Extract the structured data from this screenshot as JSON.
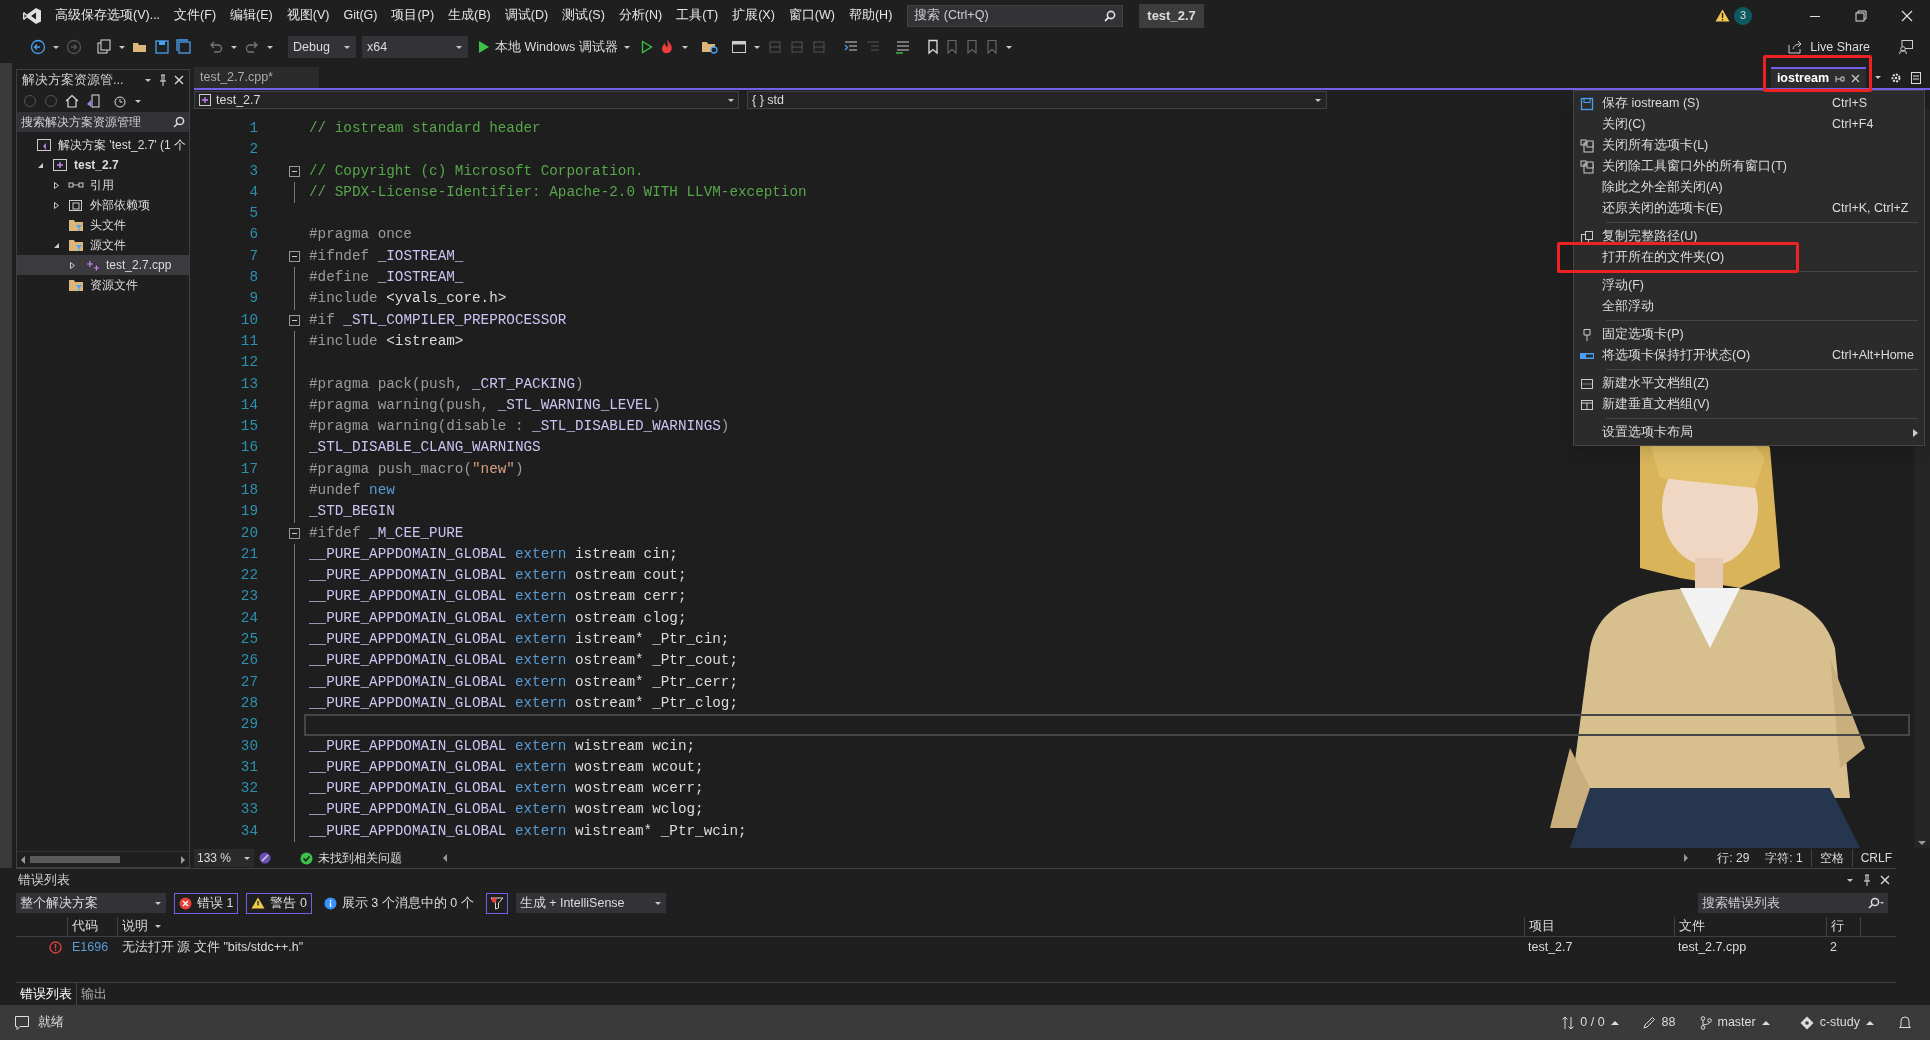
{
  "title_bar": {
    "menu": [
      "高级保存选项(V)...",
      "文件(F)",
      "编辑(E)",
      "视图(V)",
      "Git(G)",
      "项目(P)",
      "生成(B)",
      "调试(D)",
      "测试(S)",
      "分析(N)",
      "工具(T)",
      "扩展(X)",
      "窗口(W)",
      "帮助(H)"
    ],
    "search_placeholder": "搜索 (Ctrl+Q)",
    "solution_name": "test_2.7",
    "notification_count": "3"
  },
  "toolbar": {
    "configuration": "Debug",
    "platform": "x64",
    "run_target": "本地 Windows 调试器",
    "live_share": "Live Share"
  },
  "solution_explorer": {
    "title": "解决方案资源管...",
    "search_placeholder": "搜索解决方案资源管理",
    "tree": [
      {
        "label": "解决方案 'test_2.7' (1 个",
        "kind": "solution",
        "expandable": false,
        "selected": false,
        "children": [
          {
            "label": "test_2.7",
            "kind": "project",
            "expandable": true,
            "expanded": true,
            "selected": false,
            "children": [
              {
                "label": "引用",
                "kind": "reference",
                "expandable": true,
                "expanded": false,
                "selected": false
              },
              {
                "label": "外部依赖项",
                "kind": "external",
                "expandable": true,
                "expanded": false,
                "selected": false
              },
              {
                "label": "头文件",
                "kind": "folder",
                "expandable": false,
                "selected": false
              },
              {
                "label": "源文件",
                "kind": "folder",
                "expandable": true,
                "expanded": true,
                "selected": false,
                "children": [
                  {
                    "label": "test_2.7.cpp",
                    "kind": "file",
                    "expandable": true,
                    "expanded": false,
                    "selected": true
                  }
                ]
              },
              {
                "label": "资源文件",
                "kind": "folder",
                "expandable": false,
                "selected": false
              }
            ]
          }
        ]
      }
    ]
  },
  "editor": {
    "tabs": [
      {
        "label": "test_2.7.cpp*",
        "selected": false,
        "marked": false
      },
      {
        "label": "iostream",
        "selected": true,
        "marked": true
      }
    ],
    "project_dropdown": "test_2.7",
    "scope_dropdown": "{ } std",
    "lines": [
      {
        "number": "1",
        "fold": false,
        "current": false,
        "tokens": [
          {
            "kind": "comment",
            "text": "// iostream standard header"
          }
        ]
      },
      {
        "number": "2",
        "fold": false,
        "current": false
      },
      {
        "number": "3",
        "fold": true,
        "current": false,
        "tokens": [
          {
            "kind": "comment",
            "text": "// Copyright (c) Microsoft Corporation."
          }
        ]
      },
      {
        "number": "4",
        "fold": false,
        "current": false,
        "tokens": [
          {
            "kind": "comment",
            "text": "// SPDX-License-Identifier: Apache-2.0 WITH LLVM-exception"
          }
        ]
      },
      {
        "number": "5",
        "fold": false,
        "current": false
      },
      {
        "number": "6",
        "fold": false,
        "current": false,
        "tokens": [
          {
            "kind": "directive",
            "text": "#pragma once"
          }
        ]
      },
      {
        "number": "7",
        "fold": true,
        "current": false,
        "tokens": [
          {
            "kind": "directive",
            "text": "#ifndef "
          },
          {
            "kind": "macro",
            "text": "_IOSTREAM_"
          }
        ]
      },
      {
        "number": "8",
        "fold": false,
        "current": false,
        "tokens": [
          {
            "kind": "directive",
            "text": "#define "
          },
          {
            "kind": "macro",
            "text": "_IOSTREAM_"
          }
        ]
      },
      {
        "number": "9",
        "fold": false,
        "current": false,
        "tokens": [
          {
            "kind": "directive",
            "text": "#include "
          },
          {
            "kind": "plain",
            "text": "<yvals_core.h>"
          }
        ]
      },
      {
        "number": "10",
        "fold": true,
        "current": false,
        "tokens": [
          {
            "kind": "directive",
            "text": "#if "
          },
          {
            "kind": "macro",
            "text": "_STL_COMPILER_PREPROCESSOR"
          }
        ]
      },
      {
        "number": "11",
        "fold": false,
        "current": false,
        "tokens": [
          {
            "kind": "directive",
            "text": "#include "
          },
          {
            "kind": "plain",
            "text": "<istream>"
          }
        ]
      },
      {
        "number": "12",
        "fold": false,
        "current": false
      },
      {
        "number": "13",
        "fold": false,
        "current": false,
        "tokens": [
          {
            "kind": "directive",
            "text": "#pragma pack(push, "
          },
          {
            "kind": "macro",
            "text": "_CRT_PACKING"
          },
          {
            "kind": "directive",
            "text": ")"
          }
        ]
      },
      {
        "number": "14",
        "fold": false,
        "current": false,
        "tokens": [
          {
            "kind": "directive",
            "text": "#pragma warning(push, "
          },
          {
            "kind": "macro",
            "text": "_STL_WARNING_LEVEL"
          },
          {
            "kind": "directive",
            "text": ")"
          }
        ]
      },
      {
        "number": "15",
        "fold": false,
        "current": false,
        "tokens": [
          {
            "kind": "directive",
            "text": "#pragma warning(disable : "
          },
          {
            "kind": "macro",
            "text": "_STL_DISABLED_WARNINGS"
          },
          {
            "kind": "directive",
            "text": ")"
          }
        ]
      },
      {
        "number": "16",
        "fold": false,
        "current": false,
        "tokens": [
          {
            "kind": "macro",
            "text": "_STL_DISABLE_CLANG_WARNINGS"
          }
        ]
      },
      {
        "number": "17",
        "fold": false,
        "current": false,
        "tokens": [
          {
            "kind": "directive",
            "text": "#pragma push_macro("
          },
          {
            "kind": "string",
            "text": "\"new\""
          },
          {
            "kind": "directive",
            "text": ")"
          }
        ]
      },
      {
        "number": "18",
        "fold": false,
        "current": false,
        "tokens": [
          {
            "kind": "directive",
            "text": "#undef "
          },
          {
            "kind": "keyword",
            "text": "new"
          }
        ]
      },
      {
        "number": "19",
        "fold": false,
        "current": false,
        "tokens": [
          {
            "kind": "macro",
            "text": "_STD_BEGIN"
          }
        ]
      },
      {
        "number": "20",
        "fold": true,
        "current": false,
        "tokens": [
          {
            "kind": "directive",
            "text": "#ifdef "
          },
          {
            "kind": "macro",
            "text": "_M_CEE_PURE"
          }
        ]
      },
      {
        "number": "21",
        "fold": false,
        "current": false,
        "tokens": [
          {
            "kind": "macro",
            "text": "__PURE_APPDOMAIN_GLOBAL "
          },
          {
            "kind": "keyword",
            "text": "extern"
          },
          {
            "kind": "plain",
            "text": " istream cin;"
          }
        ]
      },
      {
        "number": "22",
        "fold": false,
        "current": false,
        "tokens": [
          {
            "kind": "macro",
            "text": "__PURE_APPDOMAIN_GLOBAL "
          },
          {
            "kind": "keyword",
            "text": "extern"
          },
          {
            "kind": "plain",
            "text": " ostream cout;"
          }
        ]
      },
      {
        "number": "23",
        "fold": false,
        "current": false,
        "tokens": [
          {
            "kind": "macro",
            "text": "__PURE_APPDOMAIN_GLOBAL "
          },
          {
            "kind": "keyword",
            "text": "extern"
          },
          {
            "kind": "plain",
            "text": " ostream cerr;"
          }
        ]
      },
      {
        "number": "24",
        "fold": false,
        "current": false,
        "tokens": [
          {
            "kind": "macro",
            "text": "__PURE_APPDOMAIN_GLOBAL "
          },
          {
            "kind": "keyword",
            "text": "extern"
          },
          {
            "kind": "plain",
            "text": " ostream clog;"
          }
        ]
      },
      {
        "number": "25",
        "fold": false,
        "current": false,
        "tokens": [
          {
            "kind": "macro",
            "text": "__PURE_APPDOMAIN_GLOBAL "
          },
          {
            "kind": "keyword",
            "text": "extern"
          },
          {
            "kind": "plain",
            "text": " istream* _Ptr_cin;"
          }
        ]
      },
      {
        "number": "26",
        "fold": false,
        "current": false,
        "tokens": [
          {
            "kind": "macro",
            "text": "__PURE_APPDOMAIN_GLOBAL "
          },
          {
            "kind": "keyword",
            "text": "extern"
          },
          {
            "kind": "plain",
            "text": " ostream* _Ptr_cout;"
          }
        ]
      },
      {
        "number": "27",
        "fold": false,
        "current": false,
        "tokens": [
          {
            "kind": "macro",
            "text": "__PURE_APPDOMAIN_GLOBAL "
          },
          {
            "kind": "keyword",
            "text": "extern"
          },
          {
            "kind": "plain",
            "text": " ostream* _Ptr_cerr;"
          }
        ]
      },
      {
        "number": "28",
        "fold": false,
        "current": false,
        "tokens": [
          {
            "kind": "macro",
            "text": "__PURE_APPDOMAIN_GLOBAL "
          },
          {
            "kind": "keyword",
            "text": "extern"
          },
          {
            "kind": "plain",
            "text": " ostream* _Ptr_clog;"
          }
        ]
      },
      {
        "number": "29",
        "fold": false,
        "current": true
      },
      {
        "number": "30",
        "fold": false,
        "current": false,
        "tokens": [
          {
            "kind": "macro",
            "text": "__PURE_APPDOMAIN_GLOBAL "
          },
          {
            "kind": "keyword",
            "text": "extern"
          },
          {
            "kind": "plain",
            "text": " wistream wcin;"
          }
        ]
      },
      {
        "number": "31",
        "fold": false,
        "current": false,
        "tokens": [
          {
            "kind": "macro",
            "text": "__PURE_APPDOMAIN_GLOBAL "
          },
          {
            "kind": "keyword",
            "text": "extern"
          },
          {
            "kind": "plain",
            "text": " wostream wcout;"
          }
        ]
      },
      {
        "number": "32",
        "fold": false,
        "current": false,
        "tokens": [
          {
            "kind": "macro",
            "text": "__PURE_APPDOMAIN_GLOBAL "
          },
          {
            "kind": "keyword",
            "text": "extern"
          },
          {
            "kind": "plain",
            "text": " wostream wcerr;"
          }
        ]
      },
      {
        "number": "33",
        "fold": false,
        "current": false,
        "tokens": [
          {
            "kind": "macro",
            "text": "__PURE_APPDOMAIN_GLOBAL "
          },
          {
            "kind": "keyword",
            "text": "extern"
          },
          {
            "kind": "plain",
            "text": " wostream wclog;"
          }
        ]
      },
      {
        "number": "34",
        "fold": false,
        "current": false,
        "tokens": [
          {
            "kind": "macro",
            "text": "__PURE_APPDOMAIN_GLOBAL "
          },
          {
            "kind": "keyword",
            "text": "extern"
          },
          {
            "kind": "plain",
            "text": " wistream* _Ptr_wcin;"
          }
        ]
      }
    ],
    "status": {
      "zoom": "133 %",
      "issues": "未找到相关问题",
      "line": "行: 29",
      "column": "字符: 1",
      "indent": "空格",
      "line_ending": "CRLF"
    }
  },
  "context_menu": [
    {
      "kind": "item",
      "label": "保存 iostream (S)",
      "shortcut": "Ctrl+S",
      "marked": false
    },
    {
      "kind": "item",
      "label": "关闭(C)",
      "shortcut": "Ctrl+F4",
      "marked": false
    },
    {
      "kind": "item",
      "label": "关闭所有选项卡(L)",
      "marked": false
    },
    {
      "kind": "item",
      "label": "关闭除工具窗口外的所有窗口(T)",
      "marked": false
    },
    {
      "kind": "item",
      "label": "除此之外全部关闭(A)",
      "marked": false
    },
    {
      "kind": "item",
      "label": "还原关闭的选项卡(E)",
      "shortcut": "Ctrl+K, Ctrl+Z",
      "marked": false
    },
    {
      "kind": "separator"
    },
    {
      "kind": "item",
      "label": "复制完整路径(U)",
      "marked": false
    },
    {
      "kind": "item",
      "label": "打开所在的文件夹(O)",
      "marked": true
    },
    {
      "kind": "separator"
    },
    {
      "kind": "item",
      "label": "浮动(F)",
      "marked": false
    },
    {
      "kind": "item",
      "label": "全部浮动",
      "marked": false
    },
    {
      "kind": "separator"
    },
    {
      "kind": "item",
      "label": "固定选项卡(P)",
      "marked": false
    },
    {
      "kind": "item",
      "label": "将选项卡保持打开状态(O)",
      "shortcut": "Ctrl+Alt+Home",
      "marked": false
    },
    {
      "kind": "separator"
    },
    {
      "kind": "item",
      "label": "新建水平文档组(Z)",
      "marked": false
    },
    {
      "kind": "item",
      "label": "新建垂直文档组(V)",
      "marked": false
    },
    {
      "kind": "separator"
    },
    {
      "kind": "submenu",
      "label": "设置选项卡布局",
      "marked": false
    }
  ],
  "error_list": {
    "title": "错误列表",
    "scope": "整个解决方案",
    "errors": "错误 1",
    "warnings": "警告 0",
    "messages": "展示 3 个消息中的 0 个",
    "source": "生成 + IntelliSense",
    "search_placeholder": "搜索错误列表",
    "columns": {
      "code": "代码",
      "description": "说明",
      "project": "项目",
      "file": "文件",
      "line": "行"
    },
    "rows": [
      {
        "code": "E1696",
        "description": "无法打开 源 文件 \"bits/stdc++.h\"",
        "project": "test_2.7",
        "file": "test_2.7.cpp",
        "line": "2"
      }
    ],
    "tabs": [
      {
        "label": "错误列表",
        "selected": true
      },
      {
        "label": "输出",
        "selected": false
      }
    ]
  },
  "status_bar": {
    "state": "就绪",
    "sync": "0 / 0",
    "changes": "88",
    "branch": "master",
    "repository": "c-study"
  }
}
